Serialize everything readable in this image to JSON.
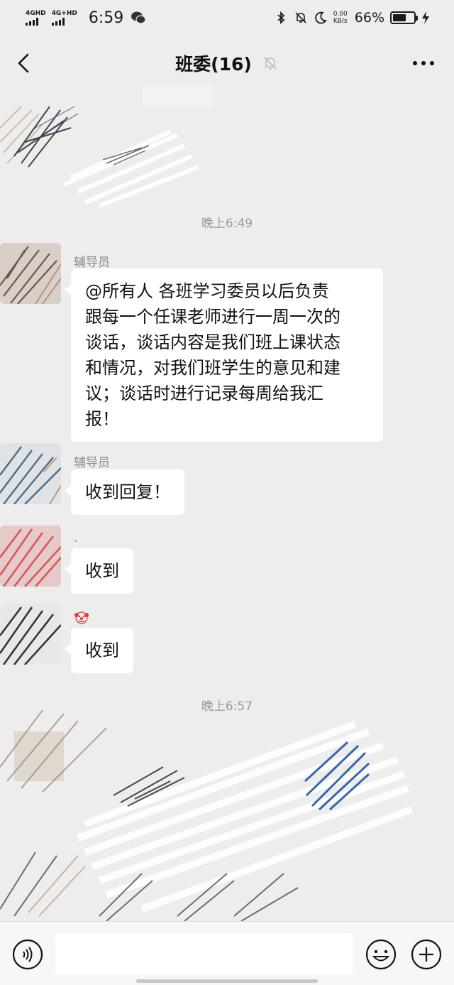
{
  "status_bar": {
    "network1": "4GHD",
    "network2": "4G+HD",
    "time": "6:59",
    "speed_value": "0.00",
    "speed_unit": "KB/s",
    "battery_percent": "66%",
    "battery_level": 0.66
  },
  "header": {
    "title": "班委(16)",
    "icons": [
      "back-chevron-icon",
      "bell-muted-icon",
      "more-dots-icon"
    ]
  },
  "messages": {
    "time_label_1": "晚上6:49",
    "msg1": {
      "sender": "辅导员",
      "lines": [
        "@所有人  各班学习委员以后负责",
        "跟每一个任课老师进行一周一次的",
        "谈话，谈话内容是我们班上课状态",
        "和情况，对我们班学生的意见和建",
        "议；谈话时进行记录每周给我汇",
        "报！"
      ]
    },
    "msg2": {
      "sender": "辅导员",
      "text": "收到回复！"
    },
    "msg3": {
      "sender": ".",
      "text": "收到"
    },
    "msg4": {
      "sender_icon": "clown-face-icon",
      "text": "收到"
    },
    "time_label_2": "晚上6:57"
  },
  "input_bar": {
    "icons": [
      "voice-icon",
      "emoji-icon",
      "plus-icon"
    ]
  },
  "colors": {
    "background": "#ededed",
    "bubble": "#ffffff",
    "scribble_blue": "#2f5fa8",
    "scribble_red": "#d94a4a"
  }
}
